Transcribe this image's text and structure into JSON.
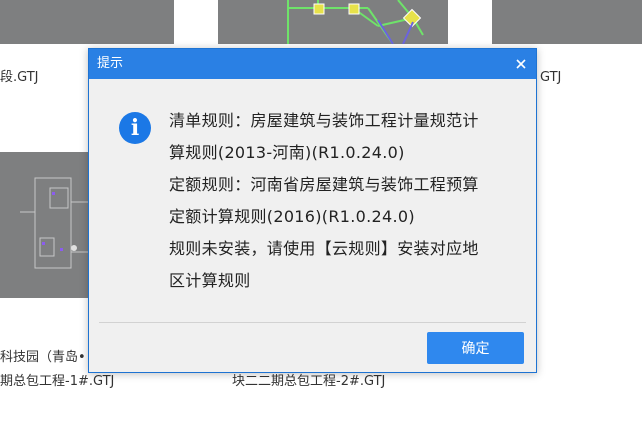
{
  "background": {
    "files": [
      {
        "label": "段.GTJ"
      },
      {
        "label": "GTJ"
      },
      {
        "label": "科技园（青岛•"
      },
      {
        "label": "期总包工程-1#.GTJ"
      },
      {
        "label": "块二二期总包工程-2#.GTJ"
      }
    ]
  },
  "dialog": {
    "title": "提示",
    "close_icon": "close-icon",
    "message_lines": [
      "清单规则：房屋建筑与装饰工程计量规范计",
      "算规则(2013-河南)(R1.0.24.0)",
      "定额规则：河南省房屋建筑与装饰工程预算",
      "定额计算规则(2016)(R1.0.24.0)",
      "规则未安装，请使用【云规则】安装对应地",
      "区计算规则"
    ],
    "ok_label": "确定"
  },
  "colors": {
    "titlebar": "#2a80e4",
    "button": "#2f88ee",
    "info_icon": "#1b78e6",
    "thumbnail": "#7e7f80"
  }
}
